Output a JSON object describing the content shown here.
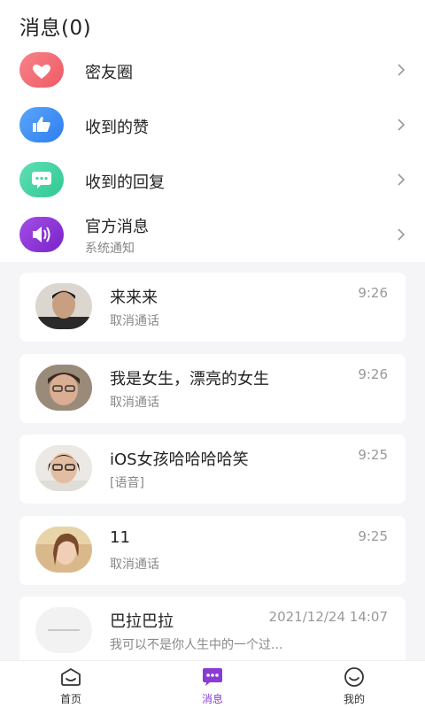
{
  "header": {
    "title": "消息(0)"
  },
  "entries": [
    {
      "label": "密友圈",
      "subtitle": "",
      "icon": "heart-icon",
      "color": "#f46b6b"
    },
    {
      "label": "收到的赞",
      "subtitle": "",
      "icon": "thumbs-up-icon",
      "color": "#3f8ff5"
    },
    {
      "label": "收到的回复",
      "subtitle": "",
      "icon": "chat-bubble-icon",
      "color": "#3ed4a0"
    },
    {
      "label": "官方消息",
      "subtitle": "系统通知",
      "icon": "speaker-icon",
      "color": "#8a33d8"
    }
  ],
  "conversations": [
    {
      "name": "来来来",
      "preview": "取消通话",
      "time": "9:26"
    },
    {
      "name": "我是女生，漂亮的女生",
      "preview": "取消通话",
      "time": "9:26"
    },
    {
      "name": "iOS女孩哈哈哈哈笑",
      "preview": "[语音]",
      "time": "9:25"
    },
    {
      "name": "11",
      "preview": "取消通话",
      "time": "9:25"
    },
    {
      "name": "巴拉巴拉",
      "preview": "我可以不是你人生中的一个过...",
      "time": "2021/12/24 14:07"
    }
  ],
  "tabs": [
    {
      "label": "首页",
      "icon": "home-icon",
      "active": false
    },
    {
      "label": "消息",
      "icon": "message-icon",
      "active": true
    },
    {
      "label": "我的",
      "icon": "profile-icon",
      "active": false
    }
  ],
  "colors": {
    "accent": "#8a3bd6",
    "background": "#f5f5f7"
  }
}
